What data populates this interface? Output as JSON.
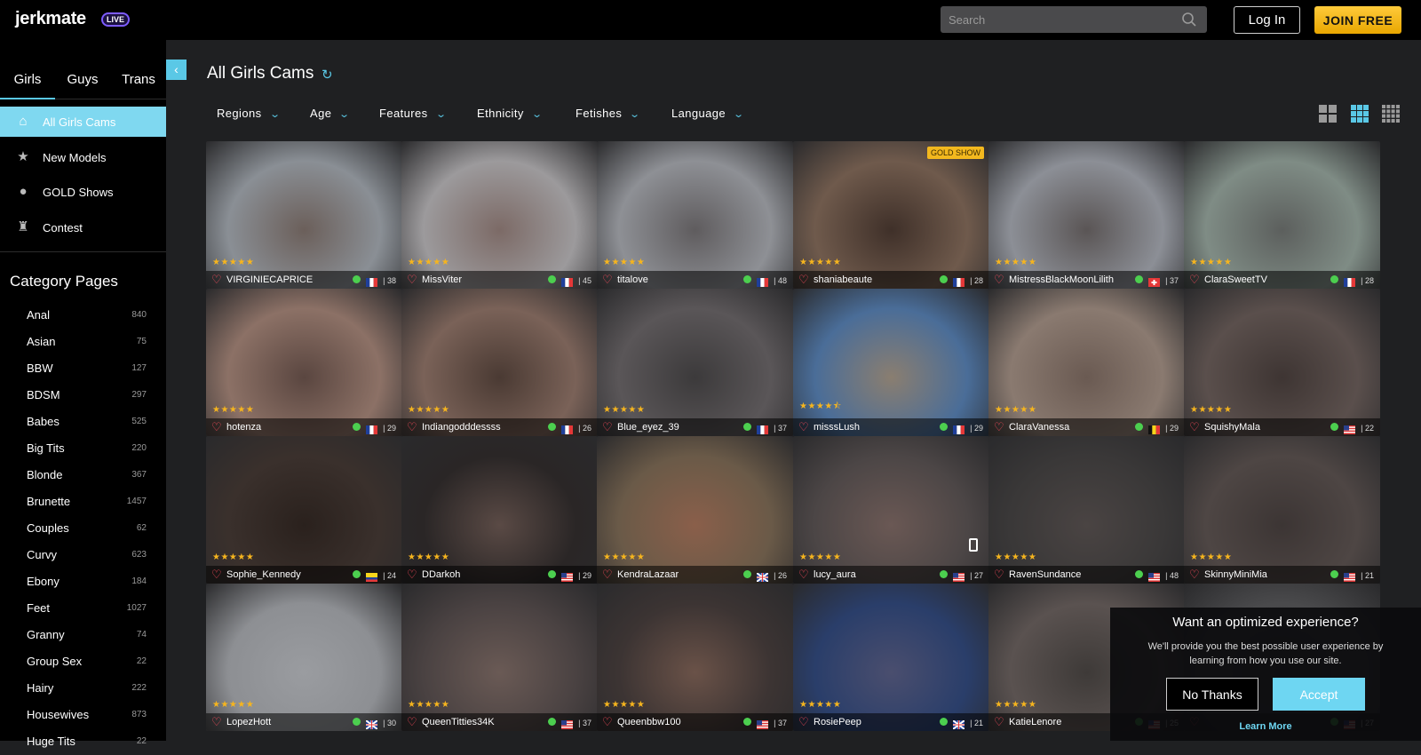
{
  "header": {
    "logo": "jerkmate",
    "live_badge": "LIVE",
    "search_placeholder": "Search",
    "login_label": "Log In",
    "join_label": "JOIN FREE"
  },
  "sidebar": {
    "tabs": [
      "Girls",
      "Guys",
      "Trans"
    ],
    "nav": [
      {
        "label": "All Girls Cams",
        "icon": "home-icon"
      },
      {
        "label": "New Models",
        "icon": "star-icon"
      },
      {
        "label": "GOLD Shows",
        "icon": "gold-coin-icon"
      },
      {
        "label": "Contest",
        "icon": "trophy-icon"
      }
    ],
    "category_title": "Category Pages",
    "categories": [
      {
        "name": "Anal",
        "count": "840"
      },
      {
        "name": "Asian",
        "count": "75"
      },
      {
        "name": "BBW",
        "count": "127"
      },
      {
        "name": "BDSM",
        "count": "297"
      },
      {
        "name": "Babes",
        "count": "525"
      },
      {
        "name": "Big Tits",
        "count": "220"
      },
      {
        "name": "Blonde",
        "count": "367"
      },
      {
        "name": "Brunette",
        "count": "1457"
      },
      {
        "name": "Couples",
        "count": "62"
      },
      {
        "name": "Curvy",
        "count": "623"
      },
      {
        "name": "Ebony",
        "count": "184"
      },
      {
        "name": "Feet",
        "count": "1027"
      },
      {
        "name": "Granny",
        "count": "74"
      },
      {
        "name": "Group Sex",
        "count": "22"
      },
      {
        "name": "Hairy",
        "count": "222"
      },
      {
        "name": "Housewives",
        "count": "873"
      },
      {
        "name": "Huge Tits",
        "count": "22"
      }
    ]
  },
  "main": {
    "title": "All Girls Cams",
    "filters": [
      "Regions",
      "Age",
      "Features",
      "Ethnicity",
      "Fetishes",
      "Language"
    ]
  },
  "cards": [
    {
      "name": "VIRGINIECAPRICE",
      "age": "38",
      "flag": "fr",
      "rating": 5,
      "tone": [
        "#8a8f95",
        "#6b5f5a"
      ],
      "gold": ""
    },
    {
      "name": "MissViter",
      "age": "45",
      "flag": "fr",
      "rating": 5,
      "tone": [
        "#9c9a9c",
        "#7c6a66"
      ],
      "gold": ""
    },
    {
      "name": "titalove",
      "age": "48",
      "flag": "fr",
      "rating": 5,
      "tone": [
        "#8e9095",
        "#5f5c5e"
      ],
      "gold": ""
    },
    {
      "name": "shaniabeaute",
      "age": "28",
      "flag": "fr",
      "rating": 5,
      "tone": [
        "#6f5a4c",
        "#3f3029"
      ],
      "gold": "GOLD SHOW"
    },
    {
      "name": "MistressBlackMoonLilith",
      "age": "37",
      "flag": "ch",
      "rating": 5,
      "tone": [
        "#8c8f96",
        "#5a5555"
      ],
      "gold": ""
    },
    {
      "name": "ClaraSweetTV",
      "age": "28",
      "flag": "fr",
      "rating": 5,
      "tone": [
        "#7f8c85",
        "#5c5f5d"
      ],
      "gold": ""
    },
    {
      "name": "hotenza",
      "age": "29",
      "flag": "fr",
      "rating": 5,
      "tone": [
        "#8c7166",
        "#5a4640"
      ],
      "gold": ""
    },
    {
      "name": "Indiangodddessss",
      "age": "26",
      "flag": "fr",
      "rating": 5,
      "tone": [
        "#7a6258",
        "#4a3a33"
      ],
      "gold": ""
    },
    {
      "name": "Blue_eyez_39",
      "age": "37",
      "flag": "fr",
      "rating": 5,
      "tone": [
        "#5a5658",
        "#3c3a3b"
      ],
      "gold": ""
    },
    {
      "name": "misssLush",
      "age": "29",
      "flag": "fr",
      "rating": 4.5,
      "tone": [
        "#4a6d98",
        "#8a7e70"
      ],
      "gold": ""
    },
    {
      "name": "ClaraVanessa",
      "age": "29",
      "flag": "be",
      "rating": 5,
      "tone": [
        "#8a7a70",
        "#6a5a52"
      ],
      "gold": ""
    },
    {
      "name": "SquishyMala",
      "age": "22",
      "flag": "us",
      "rating": 5,
      "tone": [
        "#5a4f4c",
        "#3e3533"
      ],
      "gold": ""
    },
    {
      "name": "Sophie_Kennedy",
      "age": "24",
      "flag": "co",
      "rating": 5,
      "tone": [
        "#3a302c",
        "#2a211d"
      ],
      "gold": ""
    },
    {
      "name": "DDarkoh",
      "age": "29",
      "flag": "us",
      "rating": 5,
      "tone": [
        "#2a2626",
        "#5a4a45"
      ],
      "gold": ""
    },
    {
      "name": "KendraLazaar",
      "age": "26",
      "flag": "gb",
      "rating": 5,
      "tone": [
        "#6a5a48",
        "#8a5f4a"
      ],
      "gold": ""
    },
    {
      "name": "lucy_aura",
      "age": "27",
      "flag": "us",
      "rating": 5,
      "tone": [
        "#4c4646",
        "#6a5854"
      ],
      "gold": ""
    },
    {
      "name": "RavenSundance",
      "age": "48",
      "flag": "us",
      "rating": 5,
      "tone": [
        "#3a3838",
        "#4a4443"
      ],
      "gold": ""
    },
    {
      "name": "SkinnyMiniMia",
      "age": "21",
      "flag": "us",
      "rating": 5,
      "tone": [
        "#4e4644",
        "#3c3534"
      ],
      "gold": ""
    },
    {
      "name": "LopezHott",
      "age": "30",
      "flag": "gb",
      "rating": 5,
      "tone": [
        "#8d8f93",
        "#9a9ca0"
      ],
      "gold": ""
    },
    {
      "name": "QueenTitties34K",
      "age": "37",
      "flag": "us",
      "rating": 5,
      "tone": [
        "#4a4242",
        "#6a5a55"
      ],
      "gold": ""
    },
    {
      "name": "Queenbbw100",
      "age": "37",
      "flag": "us",
      "rating": 5,
      "tone": [
        "#3c3433",
        "#6a5248"
      ],
      "gold": ""
    },
    {
      "name": "RosiePeep",
      "age": "21",
      "flag": "gb",
      "rating": 5,
      "tone": [
        "#2a3e6a",
        "#4a4e6e"
      ],
      "gold": ""
    },
    {
      "name": "KatieLenore",
      "age": "25",
      "flag": "us",
      "rating": 5,
      "tone": [
        "#5a5250",
        "#3e3a38"
      ],
      "gold": ""
    },
    {
      "name": "",
      "age": "27",
      "flag": "us",
      "rating": 5,
      "tone": [
        "#4a4a4c",
        "#3a3a3c"
      ],
      "gold": ""
    }
  ],
  "cookie": {
    "title": "Want an optimized experience?",
    "text": "We'll provide you the best possible user experience by learning from how you use our site.",
    "no_label": "No Thanks",
    "accept_label": "Accept",
    "learn_more": "Learn More"
  }
}
